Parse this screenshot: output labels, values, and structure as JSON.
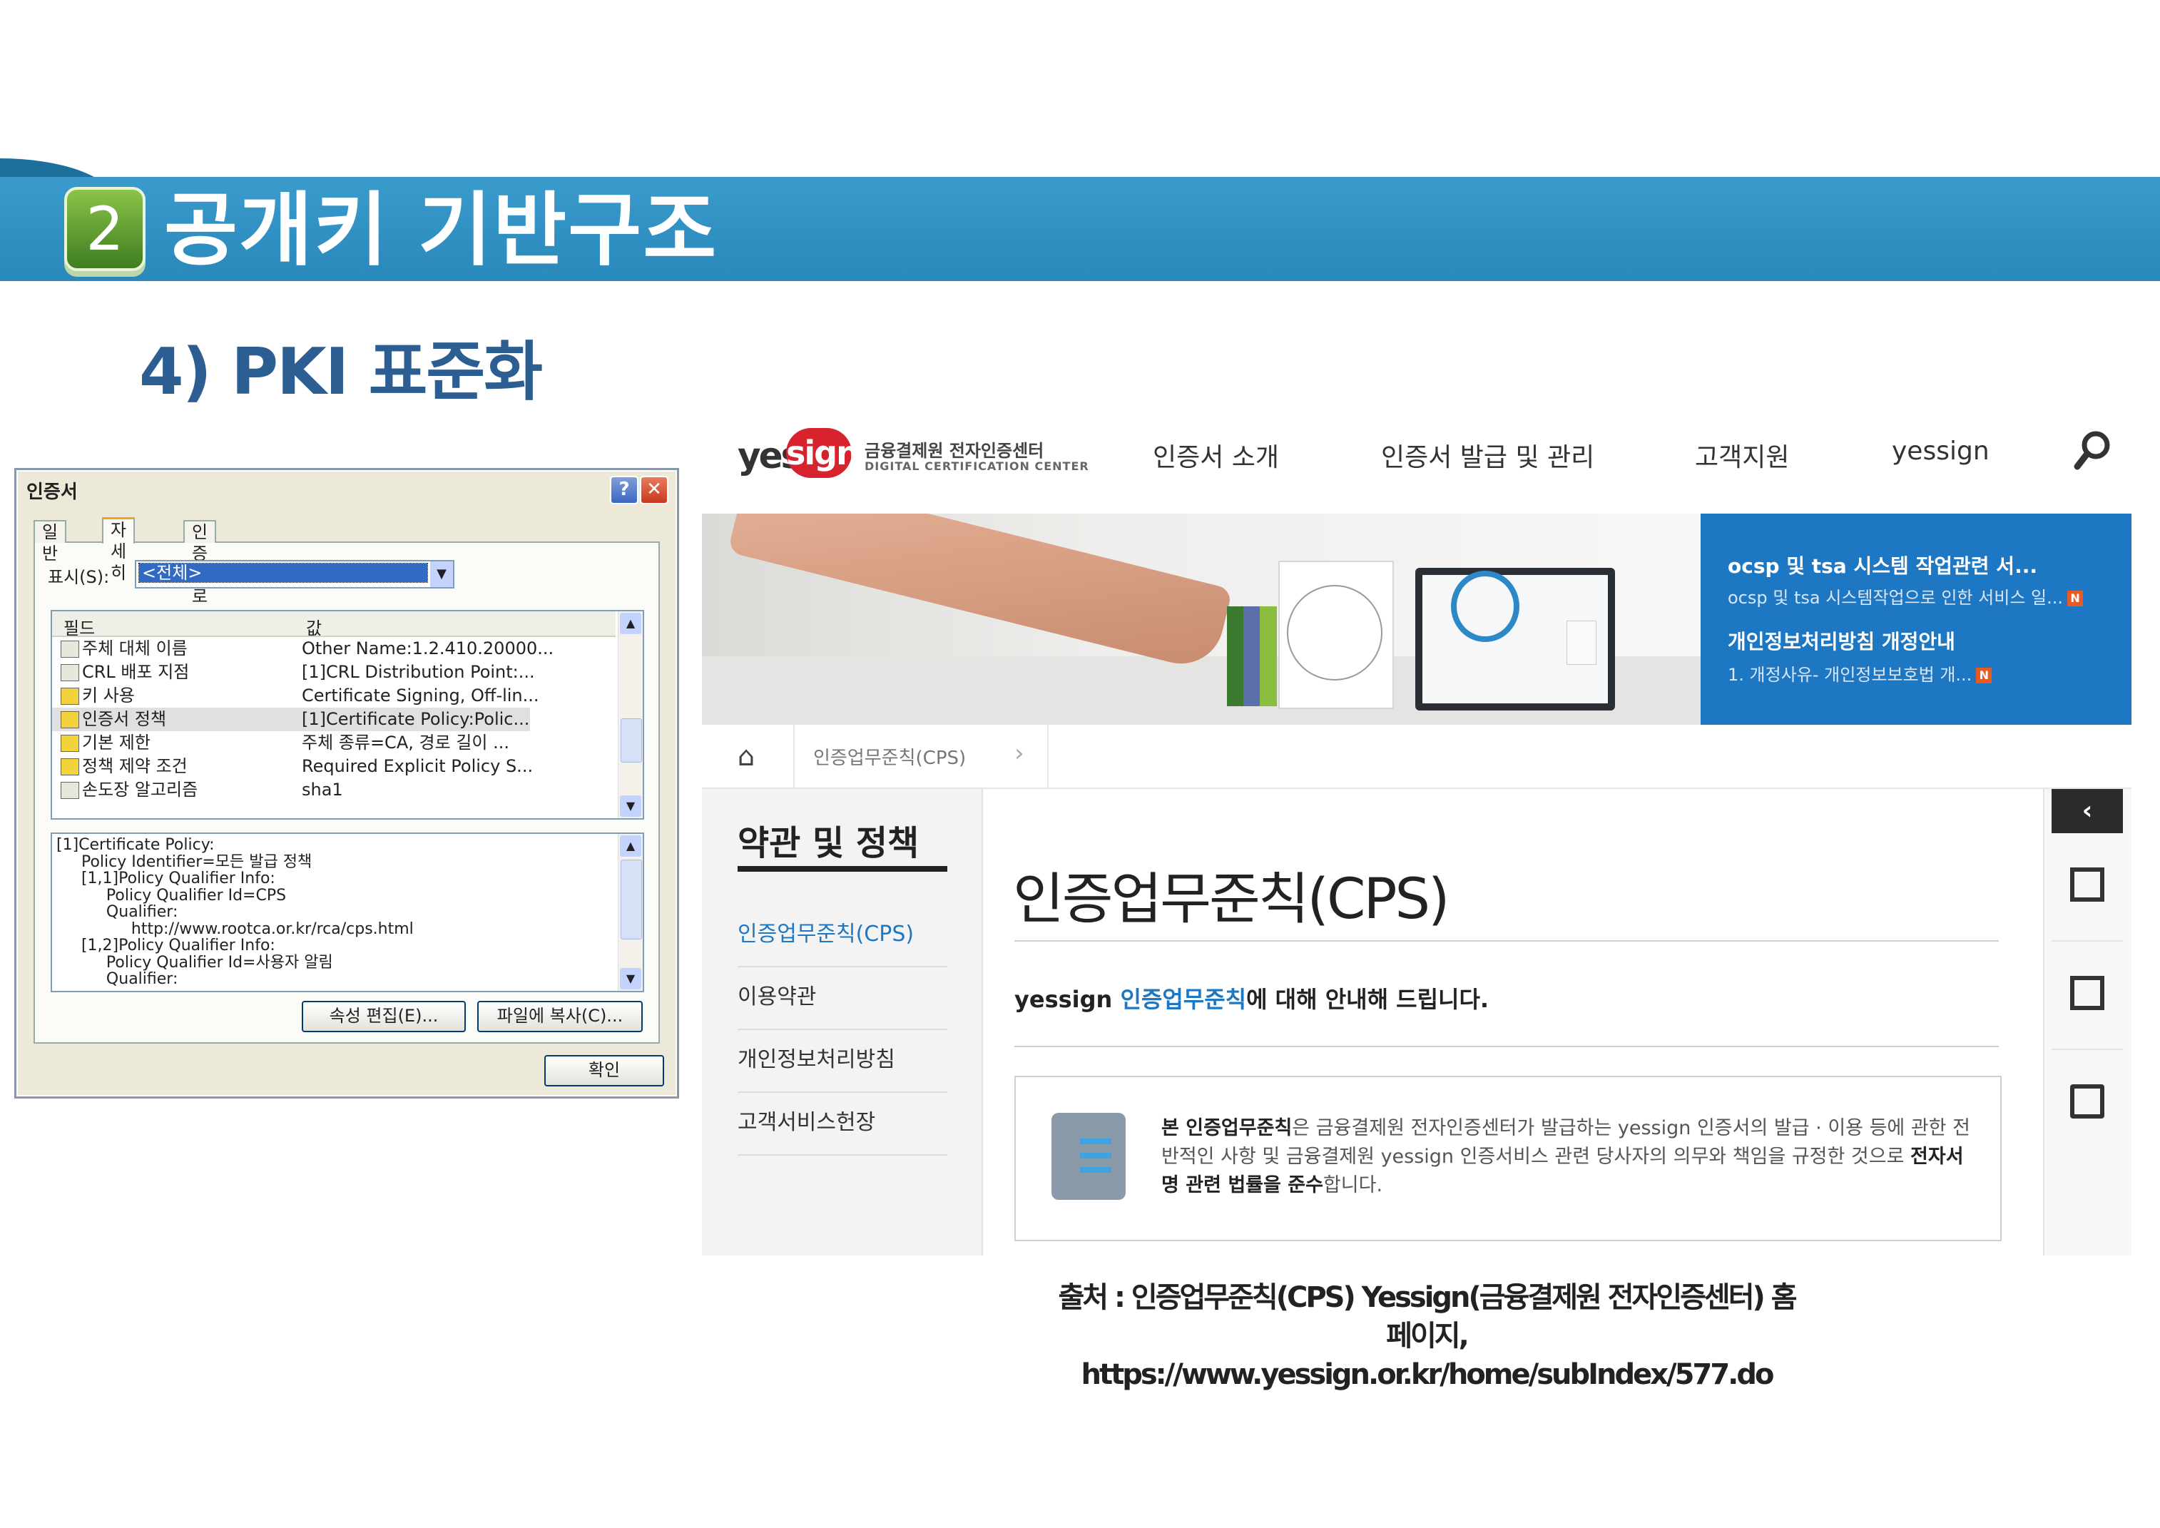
{
  "slide": {
    "number": "2",
    "title": "공개키 기반구조",
    "subtitle": "4) PKI 표준화",
    "source_line1": "출처 : 인증업무준칙(CPS) Yessign(금융결제원 전자인증센터) 홈페이지,",
    "source_line2": "https://www.yessign.or.kr/home/subIndex/577.do"
  },
  "dialog": {
    "title": "인증서",
    "help": "?",
    "close": "✕",
    "tabs": [
      "일반",
      "자세히",
      "인증 경로"
    ],
    "show_label": "표시(S):",
    "show_value": "<전체>",
    "columns": [
      "필드",
      "값"
    ],
    "rows": [
      {
        "name": "주체 대체 이름",
        "value": "Other Name:1.2.410.20000...",
        "icon": "cert-field-icon"
      },
      {
        "name": "CRL 배포 지점",
        "value": "[1]CRL Distribution Point:...",
        "icon": "cert-field-icon"
      },
      {
        "name": "키 사용",
        "value": "Certificate Signing, Off-lin...",
        "icon": "warning-field-icon"
      },
      {
        "name": "인증서 정책",
        "value": "[1]Certificate Policy:Polic...",
        "icon": "warning-field-icon"
      },
      {
        "name": "기본 제한",
        "value": "주체 종류=CA, 경로 길이 ...",
        "icon": "warning-field-icon"
      },
      {
        "name": "정책 제약 조건",
        "value": "Required Explicit Policy S...",
        "icon": "warning-field-icon"
      },
      {
        "name": "손도장 알고리즘",
        "value": "sha1",
        "icon": "cert-field-icon"
      }
    ],
    "detail_text": "[1]Certificate Policy:\n     Policy Identifier=모든 발급 정책\n     [1,1]Policy Qualifier Info:\n          Policy Qualifier Id=CPS\n          Qualifier:\n               http://www.rootca.or.kr/rca/cps.html\n     [1,2]Policy Qualifier Info:\n          Policy Qualifier Id=사용자 알림\n          Qualifier:",
    "edit_button": "속성 편집(E)...",
    "copy_button": "파일에 복사(C)...",
    "ok_button": "확인"
  },
  "site": {
    "logo_yes": "yes",
    "logo_sign": "sign",
    "logo_kr": "금융결제원 전자인증센터",
    "logo_en": "DIGITAL CERTIFICATION CENTER",
    "nav": [
      "인증서 소개",
      "인증서 발급 및 관리",
      "고객지원",
      "yessign"
    ],
    "news": [
      {
        "title": "ocsp 및 tsa 시스템 작업관련 서...",
        "summary": "ocsp 및 tsa 시스템작업으로 인한 서비스 일...",
        "badge": "N"
      },
      {
        "title": "개인정보처리방침 개정안내",
        "summary": "1. 개정사유- 개인정보보호법 개...",
        "badge": "N"
      }
    ],
    "breadcrumb": "인증업무준칙(CPS)",
    "side_title": "약관 및 정책",
    "side_items": [
      "인증업무준칙(CPS)",
      "이용약관",
      "개인정보처리방침",
      "고객서비스헌장"
    ],
    "page_title": "인증업무준칙(CPS)",
    "lead_prefix": "yessign ",
    "lead_link": "인증업무준칙",
    "lead_suffix": "에 대해 안내해 드립니다.",
    "box_bold1": "본 인증업무준칙",
    "box_text1": "은 금융결제원 전자인증센터가 발급하는 yessign 인증서의 발급 · 이용 등에 관한 전반적인 사항 및 금융결제원 yessign 인증서비스 관련 당사자의 의무와 책임을 규정한 것으로 ",
    "box_bold2": "전자서명 관련 법률을 준수",
    "box_text2": "합니다.",
    "rail_toggle": "‹"
  }
}
